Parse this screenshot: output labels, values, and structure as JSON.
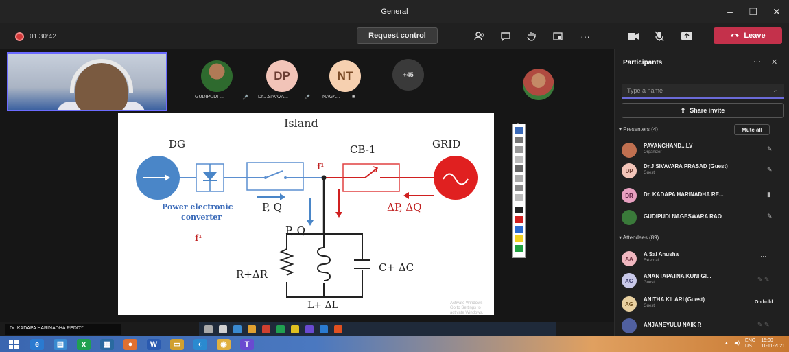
{
  "window": {
    "title": "General",
    "minimize": "–",
    "maximize": "❐",
    "close": "✕"
  },
  "toolbar": {
    "timer": "01:30:42",
    "request_control": "Request control",
    "more": "···",
    "leave": "Leave"
  },
  "avatars": [
    {
      "initials": "",
      "label": "GUDIPUDI ..."
    },
    {
      "initials": "DP",
      "label": "Dr.J.SIVAVA..."
    },
    {
      "initials": "NT",
      "label": "NAGA..."
    },
    {
      "initials": "+45",
      "label": ""
    }
  ],
  "slide": {
    "title": "Island",
    "dg": "DG",
    "cb": "CB-1",
    "grid": "GRID",
    "f1_top": "f¹",
    "pq_left": "P, Q",
    "pe_label_1": "Power electronic",
    "pe_label_2": "converter",
    "pq_mid": "P, Q",
    "dpq": "ΔP, ΔQ",
    "pq_load": "P, Q",
    "f1_bottom": "f¹",
    "r": "R+ΔR",
    "c": "C+ ΔC",
    "l": "L+ ΔL",
    "watermark_1": "Activate Windows",
    "watermark_2": "Go to Settings to activate Windows."
  },
  "presenter_label": "Dr. KADAPA HARINADHA REDDY",
  "panel": {
    "title": "Participants",
    "more": "···",
    "close": "✕",
    "search_placeholder": "Type a name",
    "share_invite": "Share invite",
    "presenters_header": "Presenters (4)",
    "mute_all": "Mute all",
    "attendees_header": "Attendees (89)",
    "presenters": [
      {
        "initials": "",
        "name": "PAVANCHAND...LV",
        "role": "Organizer",
        "color": "#c07050"
      },
      {
        "initials": "DP",
        "name": "Dr.J SIVAVARA PRASAD (Guest)",
        "role": "Guest",
        "color": "#f2c4b8"
      },
      {
        "initials": "DR",
        "name": "Dr. KADAPA HARINADHA RE...",
        "role": "",
        "color": "#e8a0c0"
      },
      {
        "initials": "",
        "name": "GUDIPUDI NAGESWARA RAO",
        "role": "",
        "color": "#3a7a3a"
      }
    ],
    "attendees": [
      {
        "initials": "AA",
        "name": "A Sai Anusha",
        "role": "External",
        "color": "#f0b8c0",
        "status": ""
      },
      {
        "initials": "AG",
        "name": "ANANTAPATNAIKUNI GI...",
        "role": "Guest",
        "color": "#c8c8e8",
        "status": ""
      },
      {
        "initials": "AG",
        "name": "ANITHA KILARI (Guest)",
        "role": "Guest",
        "color": "#e8d0a0",
        "status": "On hold"
      },
      {
        "initials": "",
        "name": "ANJANEYULU NAIK R",
        "role": "",
        "color": "#5060a0",
        "status": ""
      }
    ]
  },
  "tray": {
    "lang": "ENG",
    "region": "US",
    "time": "15:00",
    "date": "11-11-2021"
  }
}
